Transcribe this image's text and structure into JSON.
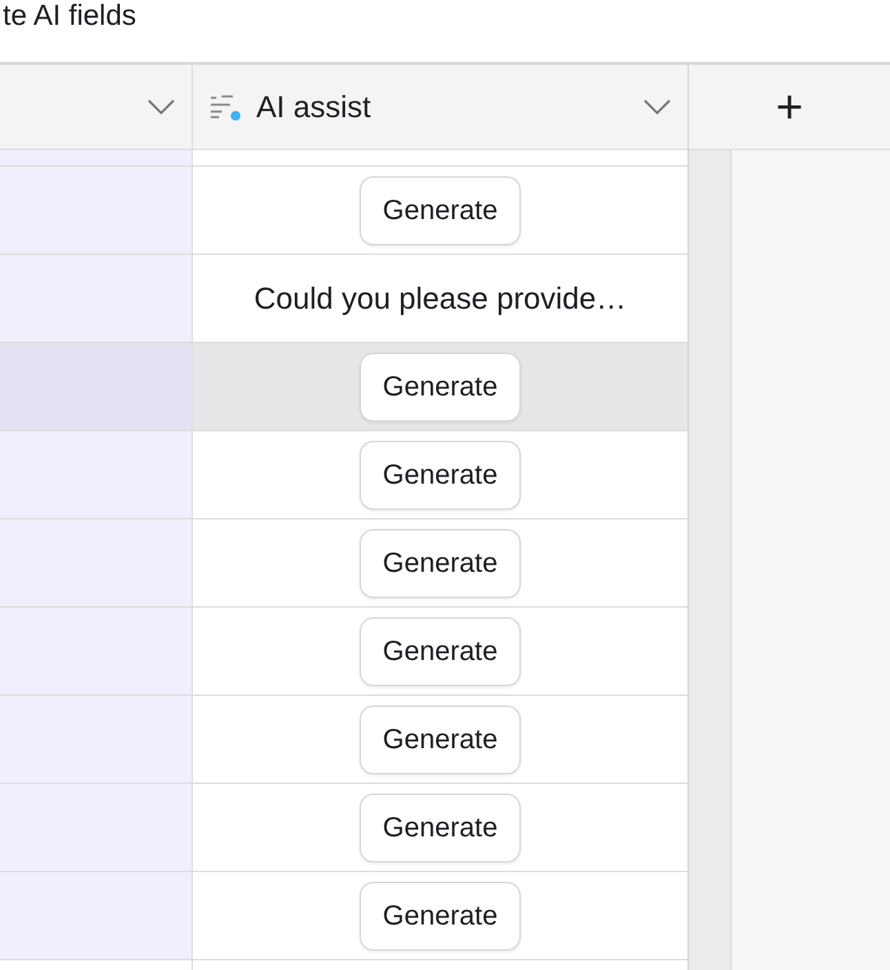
{
  "page_title": "te AI fields",
  "columns": [
    {
      "kind": "plain"
    },
    {
      "label": "AI assist",
      "kind": "ai"
    }
  ],
  "add_column": "+",
  "rows": [
    {
      "kind": "button",
      "text": "Generate",
      "hovered": false
    },
    {
      "kind": "text",
      "text": "Could you please provide…",
      "hovered": false
    },
    {
      "kind": "button",
      "text": "Generate",
      "hovered": true
    },
    {
      "kind": "button",
      "text": "Generate",
      "hovered": false
    },
    {
      "kind": "button",
      "text": "Generate",
      "hovered": false
    },
    {
      "kind": "button",
      "text": "Generate",
      "hovered": false
    },
    {
      "kind": "button",
      "text": "Generate",
      "hovered": false
    },
    {
      "kind": "button",
      "text": "Generate",
      "hovered": false
    },
    {
      "kind": "button",
      "text": "Generate",
      "hovered": false
    }
  ]
}
